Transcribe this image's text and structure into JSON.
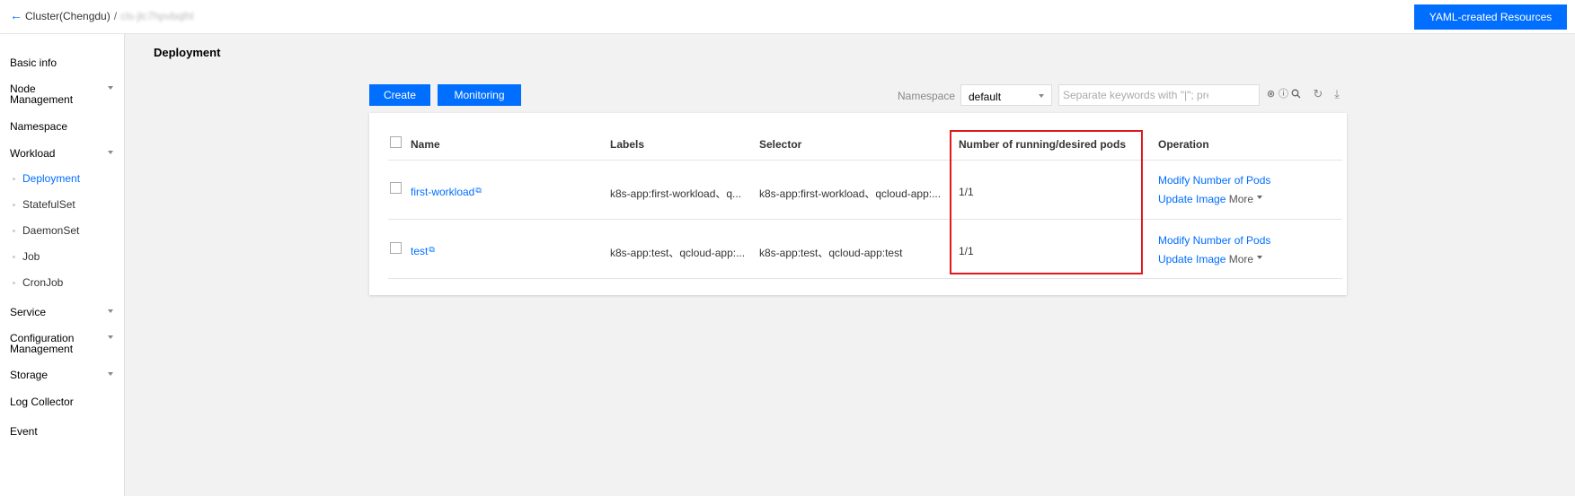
{
  "header": {
    "back_icon": "arrow-left-icon",
    "cluster": "Cluster(Chengdu)",
    "separator": "/",
    "cluster_id": "cls-jlc7hpvbqlhl",
    "yaml_button": "YAML-created Resources"
  },
  "sidebar": {
    "basic_info": "Basic info",
    "node_management": [
      "Node",
      "Management"
    ],
    "namespace": "Namespace",
    "workload": "Workload",
    "workload_items": [
      "Deployment",
      "StatefulSet",
      "DaemonSet",
      "Job",
      "CronJob"
    ],
    "service": "Service",
    "configuration_management": [
      "Configuration",
      "Management"
    ],
    "storage": "Storage",
    "log_collector": "Log Collector",
    "event": "Event"
  },
  "main": {
    "title": "Deployment",
    "create_button": "Create",
    "monitoring_button": "Monitoring",
    "namespace_label": "Namespace",
    "namespace_value": "default",
    "search_placeholder": "Separate keywords with \"|\"; press Enter"
  },
  "table": {
    "headers": {
      "name": "Name",
      "labels": "Labels",
      "selector": "Selector",
      "pods": "Number of running/desired pods",
      "operation": "Operation"
    },
    "rows": [
      {
        "name": "first-workload",
        "labels": "k8s-app:first-workload、q...",
        "selector": "k8s-app:first-workload、qcloud-app:...",
        "pods": "1/1",
        "op_modify": "Modify Number of Pods",
        "op_update": "Update Image",
        "op_more": "More"
      },
      {
        "name": "test",
        "labels": "k8s-app:test、qcloud-app:...",
        "selector": "k8s-app:test、qcloud-app:test",
        "pods": "1/1",
        "op_modify": "Modify Number of Pods",
        "op_update": "Update Image",
        "op_more": "More"
      }
    ]
  },
  "colors": {
    "accent": "#006eff",
    "highlight": "#e01a1a"
  }
}
